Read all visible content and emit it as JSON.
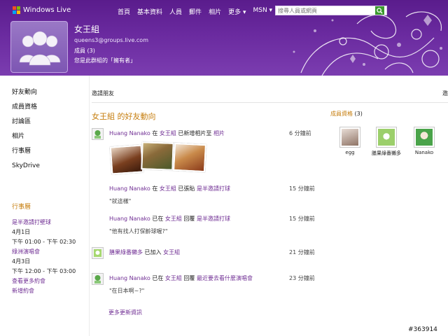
{
  "header": {
    "brand": "Windows Live",
    "nav": [
      "首頁",
      "基本資料",
      "人員",
      "郵件",
      "相片",
      "更多 ▾",
      "MSN ▾"
    ],
    "search_placeholder": "搜尋人員或網頁",
    "group": {
      "name": "女王組",
      "email": "queens3@groups.live.com",
      "members": "成員 (3)",
      "role": "您是此群組的「擁有者」"
    }
  },
  "sidebar": {
    "items": [
      "好友動向",
      "成員資格",
      "討論區",
      "相片",
      "行事曆",
      "SkyDrive"
    ],
    "calendar": {
      "title": "行事曆",
      "events": [
        {
          "title": "是半邀請打壁球",
          "date": "4月1日",
          "time": "下午 01:00 - 下午 02:30"
        },
        {
          "title": "綠洲演唱會",
          "date": "4月3日",
          "time": "下午 12:00 - 下午 03:00"
        }
      ],
      "view_more": "查看更多約會",
      "add": "新增約會"
    }
  },
  "main": {
    "invite": "邀請朋友",
    "right_cut": "邀",
    "feed_title": "女王組 的好友動向",
    "entries": [
      {
        "actor": "Huang Nanako",
        "p1": "在",
        "group": "女王組",
        "p2": "已新增相片至",
        "target": "相片",
        "quote": "",
        "time": "6 分鐘前"
      },
      {
        "actor": "Huang Nanako",
        "p1": "在",
        "group": "女王組",
        "p2": "已張貼",
        "target": "是半邀請打球",
        "quote": "\"就這樣\"",
        "time": "15 分鐘前"
      },
      {
        "actor": "Huang Nanako",
        "p1": "已在",
        "group": "女王組",
        "p2": "回覆",
        "target": "是半邀請打球",
        "quote": "\"他有找人打保齡球喔?\"",
        "time": "15 分鐘前"
      },
      {
        "actor": "膳果綠番獺多",
        "p1": "已加入",
        "group": "女王組",
        "p2": "",
        "target": "",
        "quote": "",
        "time": "21 分鐘前"
      },
      {
        "actor": "Huang Nanako",
        "p1": "已在",
        "group": "女王組",
        "p2": "回覆",
        "target": "最近要去看什麼演唱會",
        "quote": "\"在日本啊~?\"",
        "time": "23 分鐘前"
      }
    ],
    "more_updates": "更多更新資訊"
  },
  "members_panel": {
    "title": "成員資格",
    "count": "(3)",
    "members": [
      {
        "name": "egg",
        "color": "#b59a8a"
      },
      {
        "name": "膳果綠番獺多",
        "color": "#9ccf6b"
      },
      {
        "name": "Nanako",
        "color": "#4aa34a"
      }
    ]
  },
  "watermark": "#363914",
  "colors": {
    "header_purple": "#6a2a9f",
    "link_purple": "#6f2d93",
    "accent_orange": "#c67d0d",
    "search_green": "#3c9a2e"
  }
}
